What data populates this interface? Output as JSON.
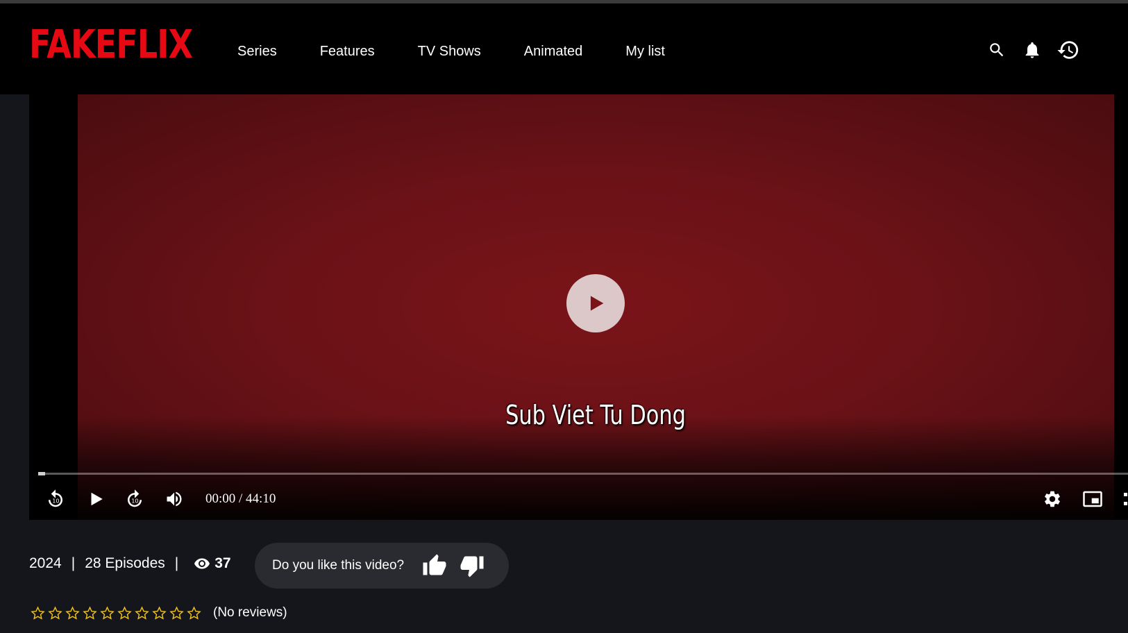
{
  "brand": {
    "logo": "FAKEFLIX",
    "color": "#e50914"
  },
  "nav": [
    {
      "label": "Series"
    },
    {
      "label": "Features"
    },
    {
      "label": "TV Shows"
    },
    {
      "label": "Animated"
    },
    {
      "label": "My list"
    }
  ],
  "header_icons": [
    "search-icon",
    "bell-icon",
    "history-icon"
  ],
  "player": {
    "subtitle": "Sub Viet Tu Dong",
    "time": "00:00 / 44:10",
    "progress": 0,
    "controls_left": [
      "rewind-10-icon",
      "play-icon",
      "forward-10-icon",
      "volume-icon"
    ],
    "controls_right": [
      "settings-gear-icon",
      "picture-in-picture-icon"
    ]
  },
  "meta": {
    "year": "2024",
    "separator": "|",
    "episodes": "28 Episodes",
    "views": "37"
  },
  "feedback": {
    "question": "Do you like this video?"
  },
  "rating": {
    "stars_total": 10,
    "stars_filled": 0,
    "reviews": "(No reviews)",
    "star_color": "#f5c518"
  }
}
